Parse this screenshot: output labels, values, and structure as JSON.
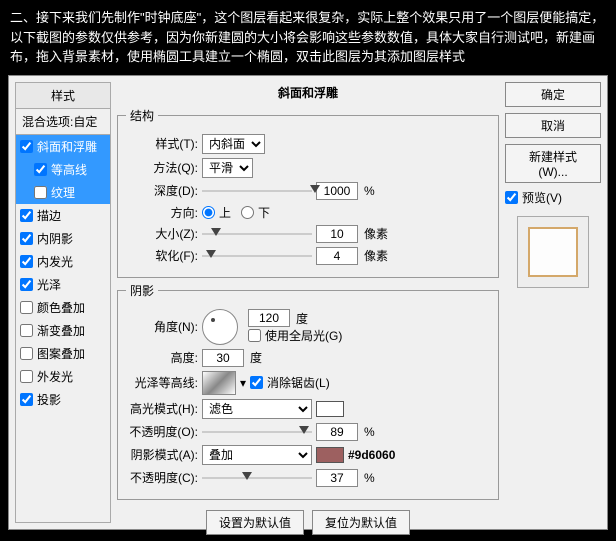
{
  "intro": "二、接下来我们先制作\"时钟底座\"，这个图层看起来很复杂，实际上整个效果只用了一个图层便能搞定，以下截图的参数仅供参考，因为你新建圆的大小将会影响这些参数数值，具体大家自行测试吧，新建画布，拖入背景素材，使用椭圆工具建立一个椭圆，双击此图层为其添加图层样式",
  "left": {
    "styles_header": "样式",
    "blend_label": "混合选项:自定",
    "items": [
      {
        "label": "斜面和浮雕",
        "checked": true,
        "selected": true,
        "indent": 0
      },
      {
        "label": "等高线",
        "checked": true,
        "selected": true,
        "indent": 1
      },
      {
        "label": "纹理",
        "checked": false,
        "selected": true,
        "indent": 1
      },
      {
        "label": "描边",
        "checked": true,
        "selected": false,
        "indent": 0
      },
      {
        "label": "内阴影",
        "checked": true,
        "selected": false,
        "indent": 0
      },
      {
        "label": "内发光",
        "checked": true,
        "selected": false,
        "indent": 0
      },
      {
        "label": "光泽",
        "checked": true,
        "selected": false,
        "indent": 0
      },
      {
        "label": "颜色叠加",
        "checked": false,
        "selected": false,
        "indent": 0
      },
      {
        "label": "渐变叠加",
        "checked": false,
        "selected": false,
        "indent": 0
      },
      {
        "label": "图案叠加",
        "checked": false,
        "selected": false,
        "indent": 0
      },
      {
        "label": "外发光",
        "checked": false,
        "selected": false,
        "indent": 0
      },
      {
        "label": "投影",
        "checked": true,
        "selected": false,
        "indent": 0
      }
    ]
  },
  "mid": {
    "title": "斜面和浮雕",
    "struct_legend": "结构",
    "style_label": "样式(T):",
    "style_value": "内斜面",
    "method_label": "方法(Q):",
    "method_value": "平滑",
    "depth_label": "深度(D):",
    "depth_value": "1000",
    "pct": "%",
    "dir_label": "方向:",
    "dir_up": "上",
    "dir_down": "下",
    "size_label": "大小(Z):",
    "size_value": "10",
    "px": "像素",
    "soften_label": "软化(F):",
    "soften_value": "4",
    "shade_legend": "阴影",
    "angle_label": "角度(N):",
    "angle_value": "120",
    "deg": "度",
    "global_label": "使用全局光(G)",
    "alt_label": "高度:",
    "alt_value": "30",
    "gloss_label": "光泽等高线:",
    "aa_label": "消除锯齿(L)",
    "hmode_label": "高光模式(H):",
    "hmode_value": "滤色",
    "hopacity_label": "不透明度(O):",
    "hopacity_value": "89",
    "smode_label": "阴影模式(A):",
    "smode_value": "叠加",
    "shadow_hex": "#9d6060",
    "sopacity_label": "不透明度(C):",
    "sopacity_value": "37",
    "btn_default": "设置为默认值",
    "btn_reset": "复位为默认值"
  },
  "right": {
    "ok": "确定",
    "cancel": "取消",
    "newstyle": "新建样式(W)...",
    "preview_label": "预览(V)"
  }
}
